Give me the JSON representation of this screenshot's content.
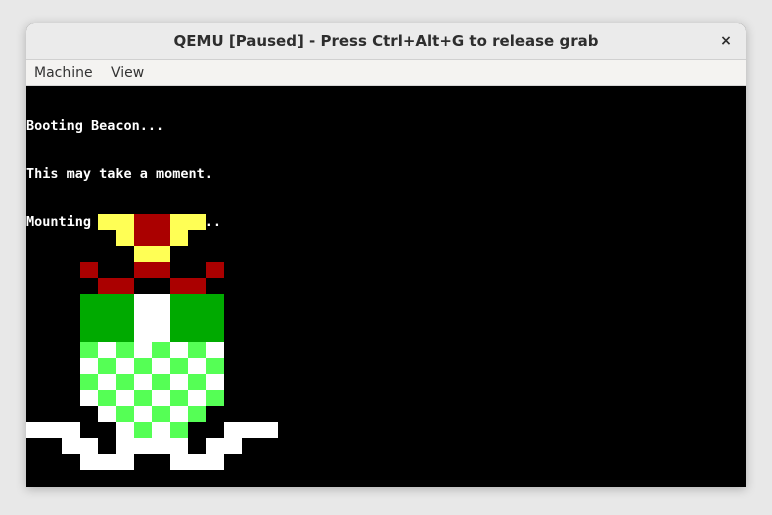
{
  "window": {
    "title": "QEMU [Paused] - Press Ctrl+Alt+G to release grab",
    "close_glyph": "×"
  },
  "menu": {
    "items": [
      "Machine",
      "View"
    ]
  },
  "console": {
    "lines": [
      "Booting Beacon...",
      "This may take a moment.",
      "Mounting file systems..."
    ]
  },
  "logo": {
    "colors": {
      "yellow": "#ffff55",
      "red": "#aa0000",
      "green": "#00aa00",
      "lightgreen": "#55ff55",
      "white": "#ffffff"
    }
  }
}
